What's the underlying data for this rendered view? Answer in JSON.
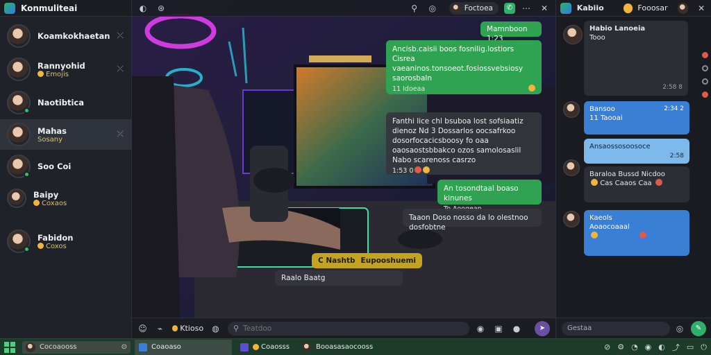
{
  "app": {
    "title": "Konmuliteai"
  },
  "contacts": [
    {
      "name": "Koamkokhaetan",
      "sub": "",
      "active": false
    },
    {
      "name": "Rannyohid",
      "sub": "Emojis",
      "active": false
    },
    {
      "name": "Naotibtica",
      "sub": "",
      "active": false
    },
    {
      "name": "Mahas",
      "sub": "Sosany",
      "active": true
    },
    {
      "name": "Soo Coi",
      "sub": "",
      "active": false
    },
    {
      "name": "Baipy",
      "sub": "Coxaos",
      "active": false
    },
    {
      "name": "Fabidon",
      "sub": "Coxos",
      "active": false
    }
  ],
  "chat_header": {
    "chip_name": "Foctoea"
  },
  "messages": [
    {
      "text": "Mamnboon 1:23",
      "style": "green"
    },
    {
      "text": "Ancisb.caisii boos fosnilig.lostiors Cisrea vaeaninos.tonsoeot.fosiossvebsiosy saorosbaln",
      "meta": "11 Idoeaa",
      "style": "green"
    },
    {
      "text": "Fanthi lice chl bsuboa lost sofsiaatiz dienoz Nd 3 Dossarlos oocsafrkoo dosorfocacicsboosy fo oaa oaosaostsbbakco ozos samolosaslil Nabo scarenoss casrzo",
      "meta": "1:53 0",
      "style": "dark"
    },
    {
      "text": "An tosondtaal boaso kinunes",
      "meta": "To Aoogean",
      "style": "green"
    },
    {
      "text": "Taaon Doso nosso da lo olestnoo dosfobtne",
      "style": "dark"
    },
    {
      "text": "C Nashtb",
      "text2": "Eupooshuemi",
      "style": "gold"
    },
    {
      "text": "Raalo Baatg",
      "style": "dark"
    }
  ],
  "composer": {
    "left_label": "Ktioso",
    "placeholder": "Teatdoo"
  },
  "right_panel": {
    "header_title": "Kabiio",
    "header_chip": "Fooosar",
    "cards": [
      {
        "title": "Habio Lanoeia",
        "body": "Tooo",
        "meta": "2:58 8",
        "style": "dark"
      },
      {
        "title": "Bansoo",
        "body": "11 Taooai",
        "meta": "2:34 2",
        "style": "blue"
      },
      {
        "title": "Ansaossosoosoce",
        "body": "",
        "meta": "2:58",
        "style": "light"
      },
      {
        "title": "Baraloa Bussd Nicdoo",
        "body": "Cas Caaos Caa",
        "meta": "",
        "style": "dark"
      },
      {
        "title": "Kaeols",
        "body": "Aoaocoaaal",
        "meta": "",
        "style": "blue"
      }
    ],
    "composer_placeholder": "Gestaa"
  },
  "taskbar": {
    "search_text": "Cocoaooss",
    "apps": [
      {
        "label": "Coaoaso",
        "active": true
      },
      {
        "label": "Coaosss",
        "active": false
      },
      {
        "label": "Booasasaocooss",
        "active": false
      }
    ]
  },
  "colors": {
    "accent_green": "#2fa352",
    "accent_blue": "#3a7fd6",
    "gold": "#c4a31f"
  }
}
